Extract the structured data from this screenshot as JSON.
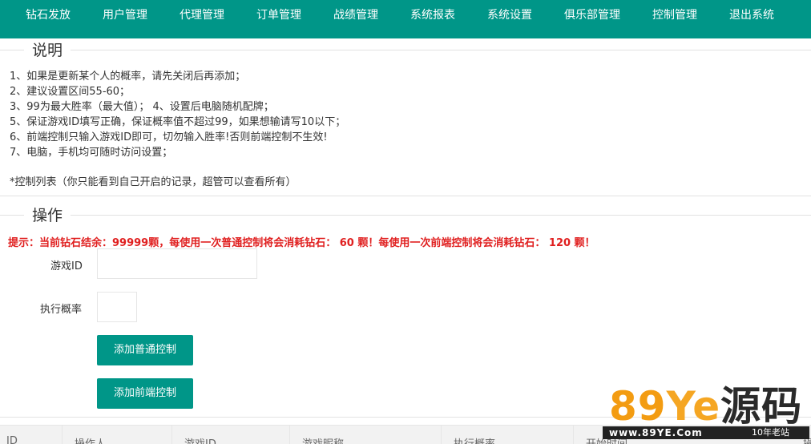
{
  "nav": {
    "items": [
      "钻石发放",
      "用户管理",
      "代理管理",
      "订单管理",
      "战绩管理",
      "系统报表",
      "系统设置",
      "俱乐部管理",
      "控制管理",
      "退出系统"
    ]
  },
  "colors": {
    "primary": "#009688",
    "warning": "#e02020"
  },
  "notes": {
    "legend": "说明",
    "lines": [
      "1、如果是更新某个人的概率，请先关闭后再添加；",
      "2、建议设置区间55-60；",
      "3、99为最大胜率（最大值）； 4、设置后电脑随机配牌；",
      "5、保证游戏ID填写正确，保证概率值不超过99，如果想输请写10以下；",
      "6、前端控制只输入游戏ID即可，切勿输入胜率!否则前端控制不生效!",
      "7、电脑，手机均可随时访问设置；"
    ],
    "footer": "*控制列表（你只能看到自己开启的记录，超管可以查看所有）"
  },
  "operation": {
    "legend": "操作",
    "tip": "提示：当前钻石结余：99999颗，每使用一次普通控制将会消耗钻石： 60 颗！每使用一次前端控制将会消耗钻石： 120 颗！",
    "game_id_label": "游戏ID",
    "game_id_value": "",
    "rate_label": "执行概率",
    "rate_value": "",
    "add_normal_label": "添加普通控制",
    "add_frontend_label": "添加前端控制"
  },
  "table": {
    "columns": [
      "ID",
      "操作人",
      "游戏ID",
      "游戏昵称",
      "执行概率",
      "开始时间",
      "操"
    ]
  },
  "watermark": {
    "digits": "89",
    "letters": "Ye",
    "chars": "源码",
    "url": "www.89YE.Com",
    "age": "10年老站"
  }
}
